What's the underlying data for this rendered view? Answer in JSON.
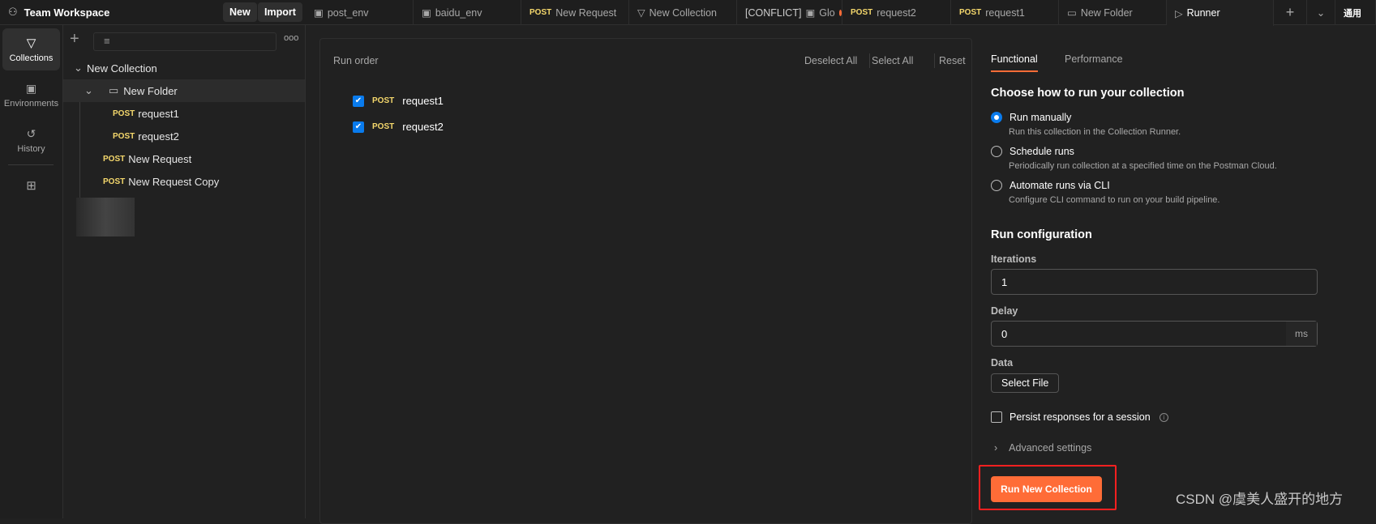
{
  "workspace": {
    "name": "Team Workspace",
    "new_label": "New",
    "import_label": "Import"
  },
  "tabs": [
    {
      "icon": "environment-icon",
      "label": "post_env"
    },
    {
      "icon": "environment-icon",
      "label": "baidu_env"
    },
    {
      "method": "POST",
      "label": "New Request"
    },
    {
      "icon": "collection-icon",
      "label": "New Collection"
    },
    {
      "prefix": "[CONFLICT]",
      "icon": "environment-icon",
      "label": "Glo",
      "unsaved": true
    },
    {
      "method": "POST",
      "label": "request2"
    },
    {
      "method": "POST",
      "label": "request1"
    },
    {
      "icon": "folder-icon",
      "label": "New Folder"
    },
    {
      "icon": "runner-icon",
      "label": "Runner",
      "active": true
    }
  ],
  "topbar_right": {
    "text": "通用"
  },
  "rail": [
    {
      "label": "Collections",
      "active": true
    },
    {
      "label": "Environments"
    },
    {
      "label": "History"
    }
  ],
  "sidebar": {
    "tree": {
      "collection": "New Collection",
      "folder": "New Folder",
      "folder_items": [
        {
          "method": "POST",
          "name": "request1"
        },
        {
          "method": "POST",
          "name": "request2"
        }
      ],
      "items": [
        {
          "method": "POST",
          "name": "New Request"
        },
        {
          "method": "POST",
          "name": "New Request Copy"
        }
      ]
    }
  },
  "run_order": {
    "title": "Run order",
    "deselect_all": "Deselect All",
    "select_all": "Select All",
    "reset": "Reset",
    "requests": [
      {
        "method": "POST",
        "name": "request1",
        "checked": true
      },
      {
        "method": "POST",
        "name": "request2",
        "checked": true
      }
    ]
  },
  "config": {
    "tabs": [
      "Functional",
      "Performance"
    ],
    "heading": "Choose how to run your collection",
    "options": [
      {
        "label": "Run manually",
        "desc": "Run this collection in the Collection Runner.",
        "selected": true
      },
      {
        "label": "Schedule runs",
        "desc": "Periodically run collection at a specified time on the Postman Cloud."
      },
      {
        "label": "Automate runs via CLI",
        "desc": "Configure CLI command to run on your build pipeline."
      }
    ],
    "run_config_heading": "Run configuration",
    "iterations_label": "Iterations",
    "iterations_value": "1",
    "delay_label": "Delay",
    "delay_value": "0",
    "delay_unit": "ms",
    "data_label": "Data",
    "select_file": "Select File",
    "persist_label": "Persist responses for a session",
    "persist_checked": false,
    "advanced": "Advanced settings",
    "run_button": "Run New Collection"
  },
  "colors": {
    "accent": "#ff6c37",
    "checkbox": "#097bed",
    "method_post": "#f5d86c",
    "highlight_box": "#ff2020"
  },
  "watermark": "CSDN @虞美人盛开的地方"
}
